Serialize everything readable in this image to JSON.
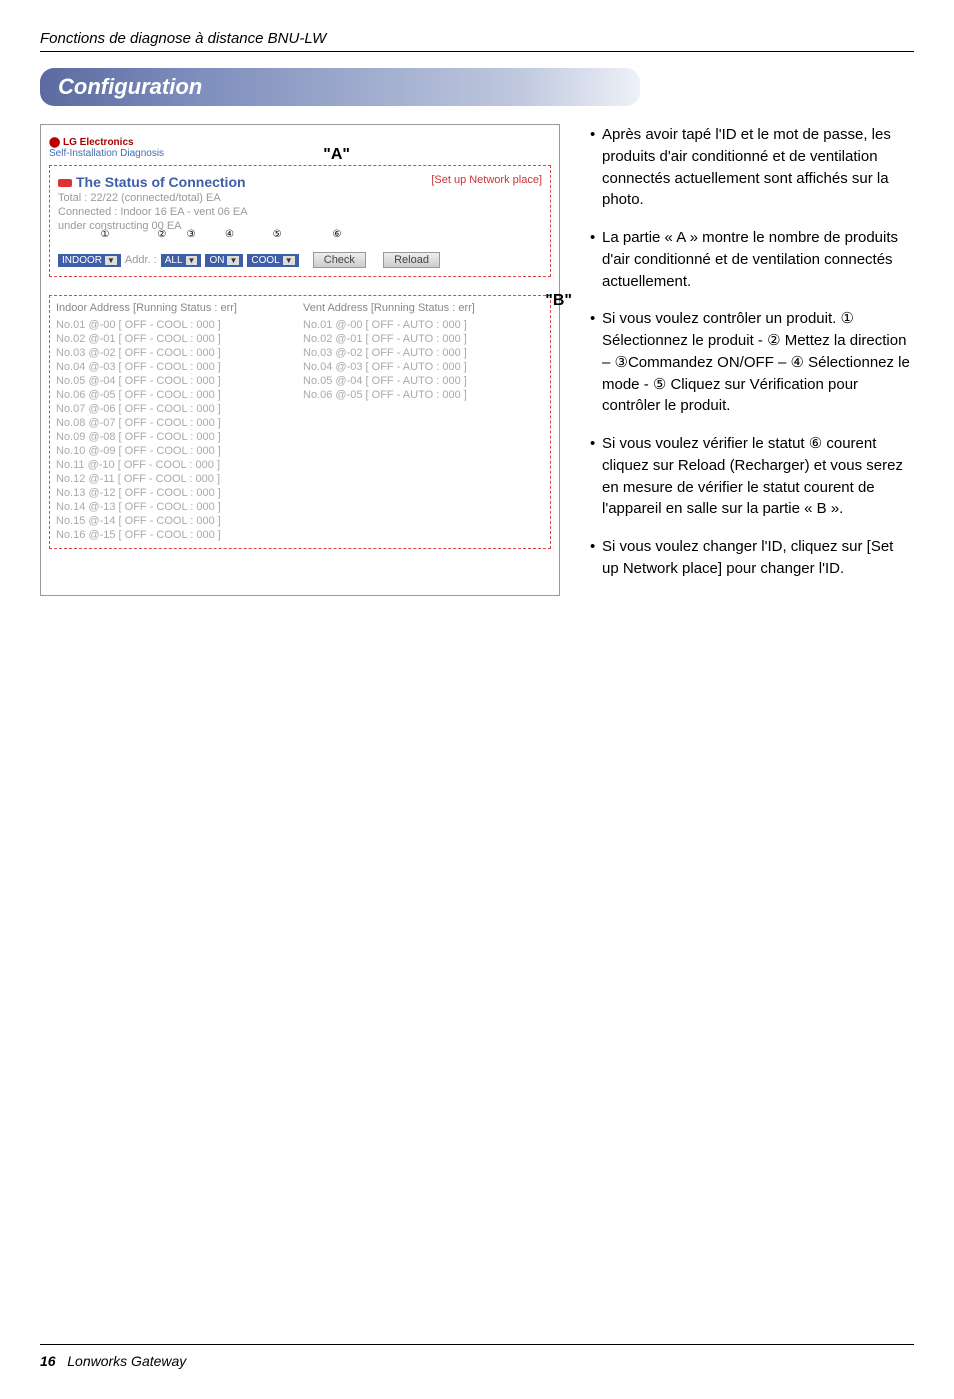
{
  "header": "Fonctions de diagnose à distance BNU-LW",
  "section": "Configuration",
  "screenshot": {
    "brand": "LG Electronics",
    "subbrand": "Self-Installation Diagnosis",
    "letter_a": "\"A\"",
    "letter_b": "\"B\"",
    "status_title": "The Status of Connection",
    "setup_link": "[Set up Network place]",
    "totals": "Total : 22/22 (connected/total) EA",
    "detail": "Connected : Indoor 16 EA - vent 06 EA",
    "under": "under constructing 00 EA",
    "labels": {
      "c1": "①",
      "c2": "②",
      "c3": "③",
      "c4": "④",
      "c5": "⑤",
      "c6": "⑥"
    },
    "sel1": "INDOOR",
    "addr_label": "Addr. :",
    "sel2": "ALL",
    "sel3": "ON",
    "sel4": "COOL",
    "btn_check": "Check",
    "btn_reload": "Reload",
    "indoor_header": "Indoor Address [Running Status : err]",
    "vent_header": "Vent   Address [Running Status : err]",
    "indoor_rows": [
      "No.01  @-00   [ OFF - COOL : 000 ]",
      "No.02  @-01   [ OFF - COOL : 000 ]",
      "No.03  @-02   [ OFF - COOL : 000 ]",
      "No.04  @-03   [ OFF - COOL : 000 ]",
      "No.05  @-04   [ OFF - COOL : 000 ]",
      "No.06  @-05   [ OFF - COOL : 000 ]",
      "No.07  @-06   [ OFF - COOL : 000 ]",
      "No.08  @-07   [ OFF - COOL : 000 ]",
      "No.09  @-08   [ OFF - COOL : 000 ]",
      "No.10  @-09   [ OFF - COOL : 000 ]",
      "No.11  @-10   [ OFF - COOL : 000 ]",
      "No.12  @-11   [ OFF - COOL : 000 ]",
      "No.13  @-12   [ OFF - COOL : 000 ]",
      "No.14  @-13   [ OFF - COOL : 000 ]",
      "No.15  @-14   [ OFF - COOL : 000 ]",
      "No.16  @-15   [ OFF - COOL : 000 ]"
    ],
    "vent_rows": [
      "No.01  @-00   [ OFF - AUTO   : 000 ]",
      "No.02  @-01   [ OFF - AUTO   : 000 ]",
      "No.03  @-02   [ OFF - AUTO   : 000 ]",
      "No.04  @-03   [ OFF - AUTO   : 000 ]",
      "No.05  @-04   [ OFF - AUTO   : 000 ]",
      "No.06  @-05   [ OFF - AUTO   : 000 ]"
    ]
  },
  "bullets": [
    "Après avoir tapé l'ID et le mot de passe, les produits d'air conditionné et de ventilation connectés actuellement sont affichés sur la photo.",
    "La partie « A » montre le nombre de produits d'air conditionné et de ventilation connectés actuellement.",
    "Si vous voulez contrôler un produit. ① Sélectionnez le produit - ② Mettez la direction – ③Commandez ON/OFF – ④ Sélectionnez le mode - ⑤ Cliquez sur Vérification pour contrôler le produit.",
    "Si vous voulez vérifier le statut ⑥ courent cliquez sur Reload (Recharger) et vous serez en mesure de vérifier le statut courent de l'appareil en salle sur la partie « B ».",
    "Si vous voulez changer l'ID, cliquez sur [Set up Network place] pour changer l'ID."
  ],
  "footer": {
    "page": "16",
    "title": "Lonworks Gateway"
  }
}
